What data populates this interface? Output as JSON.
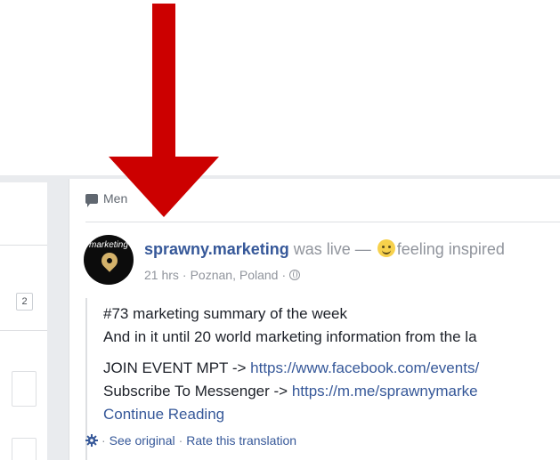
{
  "left_column": {
    "badge_count": "2"
  },
  "post": {
    "header_label": "Men",
    "author": "sprawny.marketing",
    "activity": " was live — ",
    "feeling": "feeling inspired",
    "time": "21 hrs",
    "location": "Poznan, Poland",
    "line1": "#73 marketing summary of the week",
    "line2": "And in it until 20 world marketing information from the la",
    "line3_prefix": "JOIN EVENT MPT -> ",
    "line3_link": "https://www.facebook.com/events/",
    "line4_prefix": "Subscribe To Messenger -> ",
    "line4_link": "https://m.me/sprawnymarke",
    "continue_label": "Continue Reading",
    "see_original": "See original",
    "rate_translation": "Rate this translation",
    "avatar_text": "marketing"
  },
  "colors": {
    "arrow": "#cc0000",
    "link": "#365899"
  },
  "icons": [
    "message-icon",
    "globe-icon",
    "gear-icon",
    "map-pin-icon"
  ]
}
